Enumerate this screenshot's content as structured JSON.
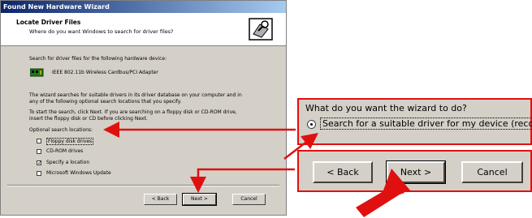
{
  "dialog": {
    "title": "Found New Hardware Wizard",
    "header_title": "Locate Driver Files",
    "header_subtitle": "Where do you want Windows to search for driver files?",
    "header_icon": "driver-search-icon",
    "intro": "Search for driver files for the following hardware device:",
    "device_icon": "network-card-icon",
    "device_name": "IEEE 802.11b Wireless Cardbus/PCI Adapter",
    "desc_line1": "The wizard searches for suitable drivers in its driver database on your computer and in",
    "desc_line2": "any of the following optional search locations that you specify.",
    "start_line1": "To start the search, click Next. If you are searching on a floppy disk or CD-ROM drive,",
    "start_line2": "insert the floppy disk or CD before clicking Next.",
    "optional_label": "Optional search locations:",
    "options": [
      {
        "label": "Floppy disk drives",
        "checked": false
      },
      {
        "label": "CD-ROM drives",
        "checked": false
      },
      {
        "label": "Specify a location",
        "checked": true
      },
      {
        "label": "Microsoft Windows Update",
        "checked": false
      }
    ],
    "back_button": "< Back",
    "next_button": "Next >",
    "cancel_button": "Cancel"
  },
  "zoom_question": {
    "question": "What do you want the wizard to do?",
    "selected_option": "Search for a suitable driver for my device (reco"
  },
  "zoom_buttons": {
    "back": "< Back",
    "next": "Next >",
    "cancel": "Cancel"
  },
  "accent_color": "#e01010"
}
